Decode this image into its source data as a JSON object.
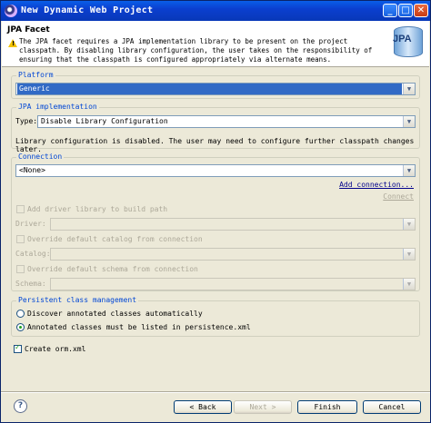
{
  "window": {
    "title": "New Dynamic Web Project"
  },
  "header": {
    "title": "JPA Facet",
    "message": "The JPA facet requires a JPA implementation library to be present on the project classpath. By disabling library configuration, the user takes on the responsibility of ensuring that the classpath is configured appropriately via alternate means.",
    "logo_text": "JPA"
  },
  "platform": {
    "label": "Platform",
    "value": "Generic"
  },
  "jpa_impl": {
    "label": "JPA implementation",
    "type_label": "Type:",
    "type_value": "Disable Library Configuration",
    "note": "Library configuration is disabled. The user may need to configure further classpath changes later."
  },
  "connection": {
    "label": "Connection",
    "value": "<None>",
    "add_link": "Add connection...",
    "connect_link": "Connect",
    "add_driver_label": "Add driver library to build path",
    "driver_label": "Driver:",
    "override_catalog_label": "Override default catalog from connection",
    "catalog_label": "Catalog:",
    "override_schema_label": "Override default schema from connection",
    "schema_label": "Schema:"
  },
  "persistent": {
    "label": "Persistent class management",
    "opt1": "Discover annotated classes automatically",
    "opt2": "Annotated classes must be listed in persistence.xml",
    "selected": "opt2"
  },
  "create_orm": {
    "label": "Create orm.xml",
    "checked": true
  },
  "buttons": {
    "back": "< Back",
    "next": "Next >",
    "finish": "Finish",
    "cancel": "Cancel"
  },
  "icons": {
    "window": "eclipse-icon",
    "warning": "warning-icon",
    "help": "help-icon"
  }
}
